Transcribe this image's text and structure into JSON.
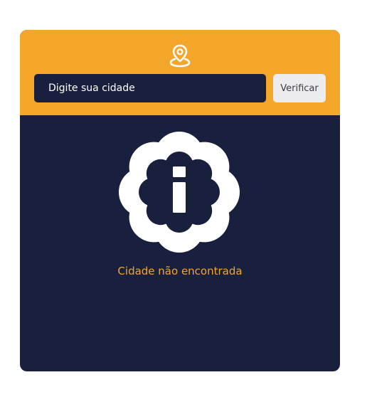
{
  "search": {
    "placeholder": "Digite sua cidade",
    "value": "",
    "button_label": "Verificar",
    "location_icon": "map-pin-icon"
  },
  "result": {
    "status_icon": "info-badge-icon",
    "message": "Cidade não encontrada"
  },
  "colors": {
    "accent": "#f4a62a",
    "panel": "#18203d",
    "button": "#ececee",
    "page": "#ffffff"
  }
}
